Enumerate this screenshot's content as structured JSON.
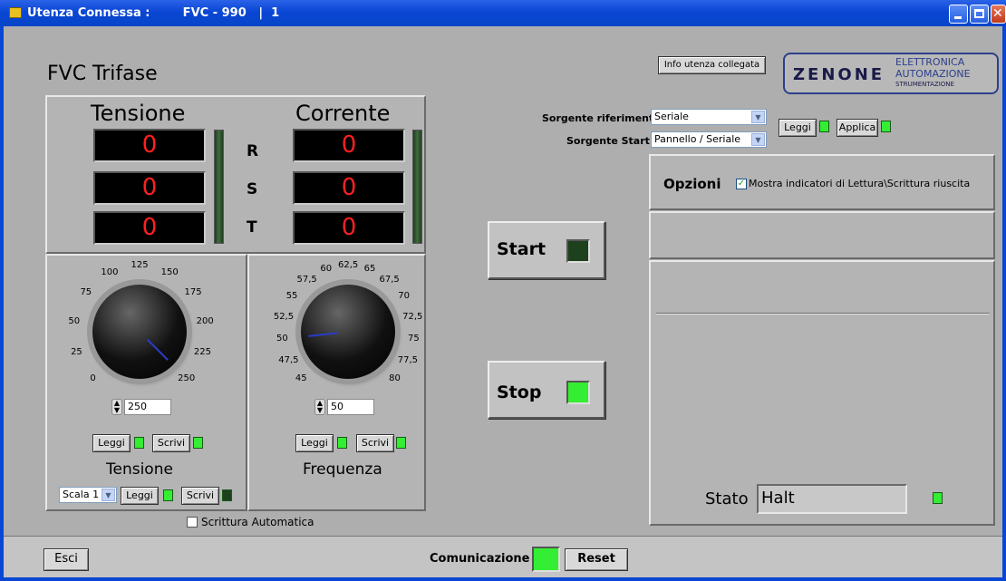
{
  "window": {
    "title": "Utenza Connessa :        FVC - 990   |  1"
  },
  "header": {
    "app_title": "FVC Trifase",
    "info_button": "Info utenza collegata"
  },
  "logo": {
    "brand": "ZENONE",
    "line1": "ELETTRONICA",
    "line2": "AUTOMAZIONE",
    "line3": "STRUMENTAZIONE"
  },
  "measures": {
    "tensione_title": "Tensione",
    "corrente_title": "Corrente",
    "phases": [
      "R",
      "S",
      "T"
    ],
    "tensione_values": [
      "0",
      "0",
      "0"
    ],
    "corrente_values": [
      "0",
      "0",
      "0"
    ]
  },
  "knob_tensione": {
    "ticks": [
      "0",
      "25",
      "50",
      "75",
      "100",
      "125",
      "150",
      "175",
      "200",
      "225",
      "250"
    ],
    "value": "250",
    "value_num": 250,
    "min": 0,
    "max": 250,
    "leggi": "Leggi",
    "scrivi": "Scrivi",
    "label": "Tensione",
    "scala": "Scala 1",
    "leggi2": "Leggi",
    "scrivi2": "Scrivi"
  },
  "knob_frequenza": {
    "ticks": [
      "45",
      "47,5",
      "50",
      "52,5",
      "55",
      "57,5",
      "60",
      "62,5",
      "65",
      "67,5",
      "70",
      "72,5",
      "75",
      "77,5",
      "80"
    ],
    "value": "50",
    "value_num": 50,
    "min": 45,
    "max": 80,
    "leggi": "Leggi",
    "scrivi": "Scrivi",
    "label": "Frequenza"
  },
  "auto_write": {
    "label": "Scrittura Automatica",
    "checked": false
  },
  "controls": {
    "start": "Start",
    "stop": "Stop",
    "start_led": "off",
    "stop_led": "on"
  },
  "source": {
    "rif_label": "Sorgente riferimento",
    "rif_value": "Seriale",
    "start_label": "Sorgente Start",
    "start_value": "Pannello / Seriale",
    "leggi": "Leggi",
    "applica": "Applica"
  },
  "options": {
    "title": "Opzioni",
    "checkbox_label": "Mostra indicatori di Lettura\\Scrittura riuscita",
    "checked": true
  },
  "status": {
    "label": "Stato",
    "value": "Halt"
  },
  "footer": {
    "esci": "Esci",
    "comunicazione": "Comunicazione",
    "reset": "Reset"
  },
  "colors": {
    "led_on": "#33ee33",
    "led_off": "#1d401d",
    "display_text": "#ff2020",
    "titlebar": "#0a46d4"
  }
}
